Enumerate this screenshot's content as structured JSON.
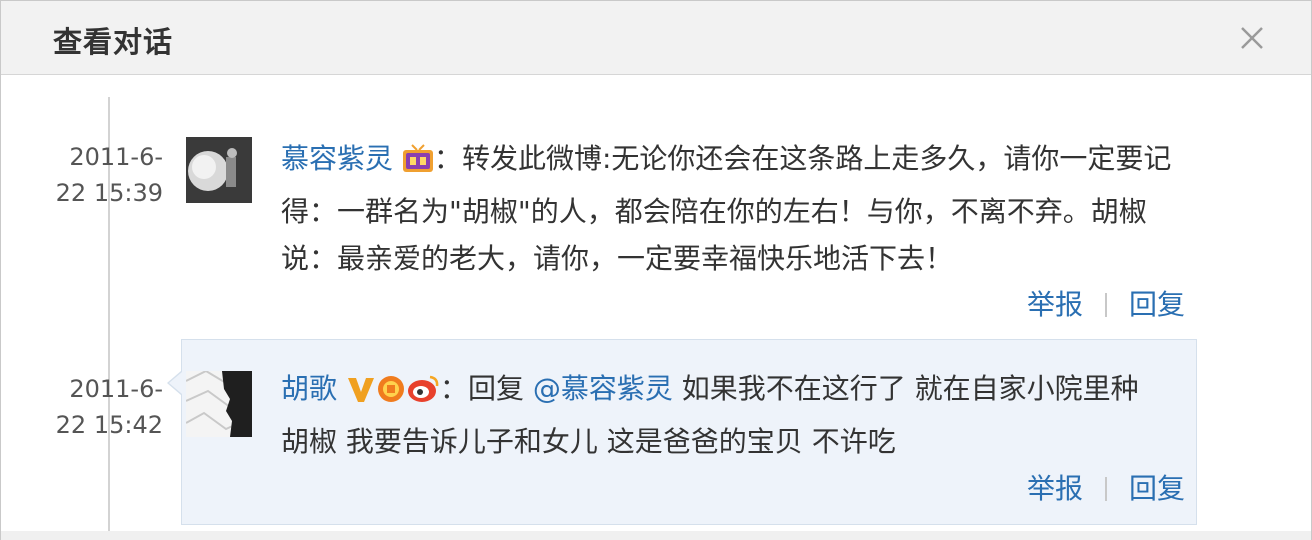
{
  "dialog": {
    "title": "查看对话",
    "close_icon": "close-icon"
  },
  "colors": {
    "link": "#2a6fb2",
    "titlebar_bg": "#f2f2f2",
    "reply_bg": "#eef3fa"
  },
  "posts": [
    {
      "time_line1": "2011-6-",
      "time_line2": "22 15:39",
      "avatar_icon": "user-avatar-1",
      "username": "慕容紫灵",
      "badge_icon": "tv-badge-icon",
      "colon": "：",
      "text_line1": "转发此微博:无论你还会在这条路上走多久，请你一定要记",
      "text_line2": "得：一群名为\"胡椒\"的人，都会陪在你的左右！与你，不离不弃。胡椒",
      "text_line3": "说：最亲爱的老大，请你，一定要幸福快乐地活下去！",
      "report_label": "举报",
      "reply_label": "回复"
    },
    {
      "time_line1": "2011-6-",
      "time_line2": "22 15:42",
      "avatar_icon": "user-avatar-2",
      "username": "胡歌",
      "verified_icon": "verified-v-icon",
      "badge_icons": [
        "medal-badge-icon",
        "weibo-badge-icon"
      ],
      "colon": "：",
      "reply_prefix": "回复 ",
      "mention": "@慕容紫灵",
      "text_line1_rest": " 如果我不在这行了 就在自家小院里种",
      "text_line2": "胡椒 我要告诉儿子和女儿 这是爸爸的宝贝 不许吃",
      "report_label": "举报",
      "reply_label": "回复"
    }
  ]
}
